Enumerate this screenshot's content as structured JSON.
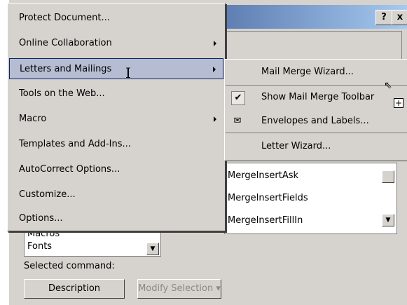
{
  "dialog": {
    "help_button": "?",
    "close_button": "x"
  },
  "commands": {
    "items": [
      "MergeInsertAsk",
      "MergeInsertFields",
      "MergeInsertFillIn"
    ]
  },
  "categories": {
    "items": [
      "Macros",
      "Fonts"
    ]
  },
  "selected_command_label": "Selected command:",
  "buttons": {
    "description": "Description",
    "modify_selection": "Modify Selection"
  },
  "tools_menu": {
    "items": [
      {
        "label": "Protect Document...",
        "has_submenu": false
      },
      {
        "label": "Online Collaboration",
        "has_submenu": true
      },
      {
        "label": "Letters and Mailings",
        "has_submenu": true,
        "selected": true
      },
      {
        "label": "Tools on the Web...",
        "has_submenu": false
      },
      {
        "label": "Macro",
        "has_submenu": true
      },
      {
        "label": "Templates and Add-Ins...",
        "has_submenu": false
      },
      {
        "label": "AutoCorrect Options...",
        "has_submenu": false
      },
      {
        "label": "Customize...",
        "has_submenu": false
      },
      {
        "label": "Options...",
        "has_submenu": false
      }
    ]
  },
  "letters_submenu": {
    "items": [
      {
        "label": "Mail Merge Wizard...",
        "icon": ""
      },
      {
        "label": "Show Mail Merge Toolbar",
        "icon": "checkmark-icon"
      },
      {
        "label": "Envelopes and Labels...",
        "icon": "envelope-icon"
      },
      {
        "label": "Letter Wizard...",
        "icon": ""
      }
    ]
  },
  "colors": {
    "title_gradient_start": "#0a246a",
    "menu_highlight": "#b6bdd2",
    "face": "#d6d3ce"
  }
}
